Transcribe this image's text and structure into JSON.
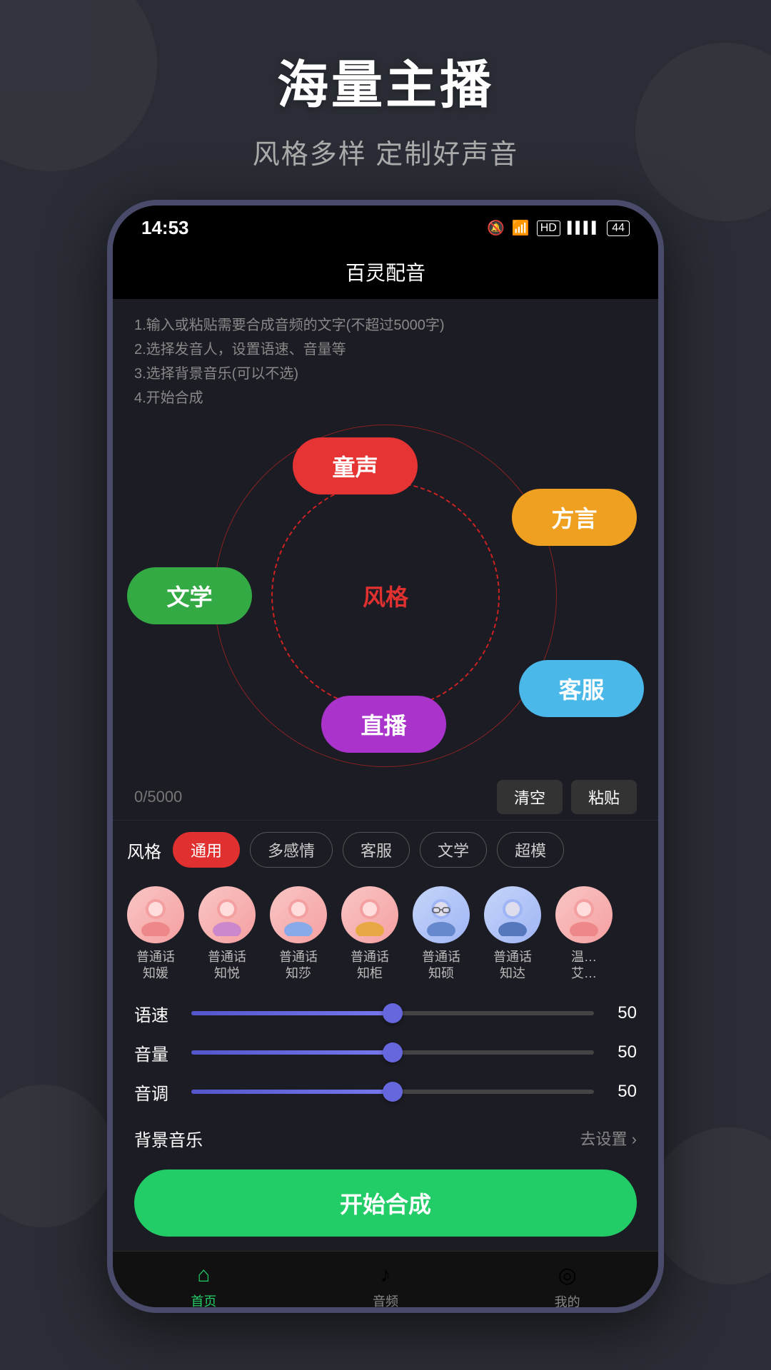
{
  "page": {
    "bg_color": "#2a2d35",
    "main_title": "海量主播",
    "sub_title": "风格多样   定制好声音"
  },
  "status_bar": {
    "time": "14:53",
    "icons": [
      "🔕",
      "📶",
      "HD",
      "4G",
      "🔋"
    ]
  },
  "app": {
    "title": "百灵配音"
  },
  "instructions": {
    "line1": "1.输入或粘贴需要合成音频的文字(不超过5000字)",
    "line2": "2.选择发音人，设置语速、音量等",
    "line3": "3.选择背景音乐(可以不选)",
    "line4": "4.开始合成"
  },
  "style_wheel": {
    "center_label": "风格",
    "bubbles": [
      {
        "label": "童声",
        "color": "#e63333",
        "position": "top-left"
      },
      {
        "label": "方言",
        "color": "#f0a020",
        "position": "top-right"
      },
      {
        "label": "文学",
        "color": "#33aa44",
        "position": "mid-left"
      },
      {
        "label": "客服",
        "color": "#4ab8e8",
        "position": "mid-right"
      },
      {
        "label": "直播",
        "color": "#aa33cc",
        "position": "bottom-center"
      }
    ]
  },
  "input_area": {
    "counter": "0/5000",
    "clear_btn": "清空",
    "paste_btn": "粘贴"
  },
  "style_filters": {
    "label": "风格",
    "tags": [
      {
        "label": "通用",
        "active": true
      },
      {
        "label": "多感情",
        "active": false
      },
      {
        "label": "客服",
        "active": false
      },
      {
        "label": "文学",
        "active": false
      },
      {
        "label": "超模",
        "active": false
      }
    ]
  },
  "voices": [
    {
      "name": "普通话\n知媛",
      "gender": "female",
      "avatar_type": "female-1"
    },
    {
      "name": "普通话\n知悦",
      "gender": "female",
      "avatar_type": "female-2"
    },
    {
      "name": "普通话\n知莎",
      "gender": "female",
      "avatar_type": "female-3"
    },
    {
      "name": "普通话\n知柜",
      "gender": "female",
      "avatar_type": "female-4"
    },
    {
      "name": "普通话\n知硕",
      "gender": "male",
      "avatar_type": "male-1"
    },
    {
      "name": "普通话\n知达",
      "gender": "male",
      "avatar_type": "male-2"
    },
    {
      "name": "温…\n艾…",
      "gender": "female",
      "avatar_type": "partial"
    }
  ],
  "sliders": [
    {
      "label": "语速",
      "value": 50,
      "pct": 50
    },
    {
      "label": "音量",
      "value": 50,
      "pct": 50
    },
    {
      "label": "音调",
      "value": 50,
      "pct": 50
    }
  ],
  "bgm": {
    "label": "背景音乐",
    "setting_label": "去设置 ›"
  },
  "start_button": {
    "label": "开始合成"
  },
  "bottom_nav": [
    {
      "label": "首页",
      "icon": "⌂",
      "active": true
    },
    {
      "label": "音频",
      "icon": "♪",
      "active": false
    },
    {
      "label": "我的",
      "icon": "◎",
      "active": false
    }
  ]
}
